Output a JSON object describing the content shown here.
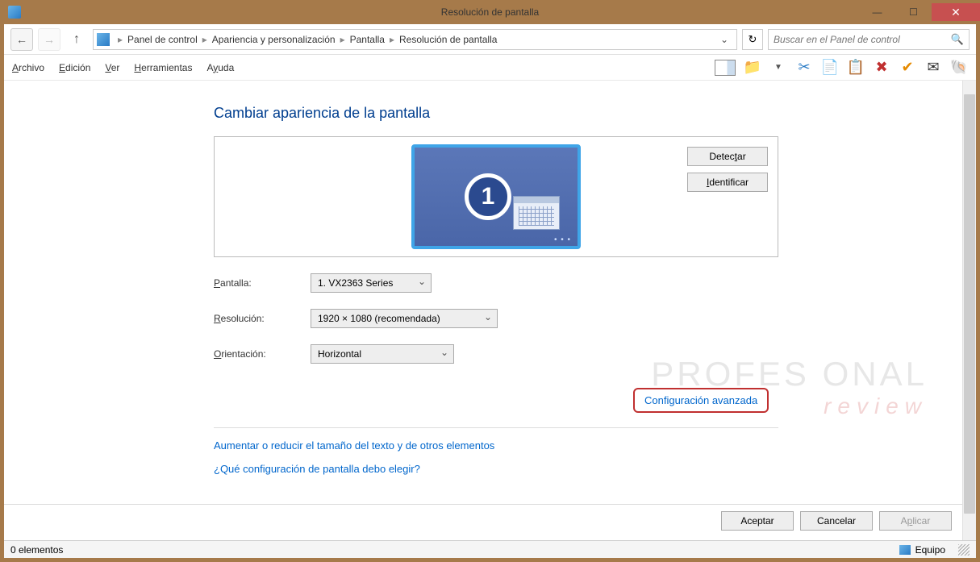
{
  "window": {
    "title": "Resolución de pantalla"
  },
  "breadcrumb": {
    "items": [
      "Panel de control",
      "Apariencia y personalización",
      "Pantalla",
      "Resolución de pantalla"
    ]
  },
  "search": {
    "placeholder": "Buscar en el Panel de control"
  },
  "menu": {
    "file": "Archivo",
    "edit": "Edición",
    "view": "Ver",
    "tools": "Herramientas",
    "help": "Ayuda"
  },
  "heading": "Cambiar apariencia de la pantalla",
  "monitor": {
    "number": "1"
  },
  "buttons": {
    "detect": "Detectar",
    "identify": "Identificar",
    "ok": "Aceptar",
    "cancel": "Cancelar",
    "apply": "Aplicar"
  },
  "labels": {
    "display": "Pantalla:",
    "resolution": "Resolución:",
    "orientation": "Orientación:"
  },
  "values": {
    "display": "1. VX2363 Series",
    "resolution": "1920 × 1080 (recomendada)",
    "orientation": "Horizontal"
  },
  "links": {
    "advanced": "Configuración avanzada",
    "resize": "Aumentar o reducir el tamaño del texto y de otros elementos",
    "which": "¿Qué configuración de pantalla debo elegir?"
  },
  "status": {
    "left": "0 elementos",
    "right": "Equipo"
  },
  "watermark": {
    "line1": "PROFES  ONAL",
    "line2": "review"
  }
}
